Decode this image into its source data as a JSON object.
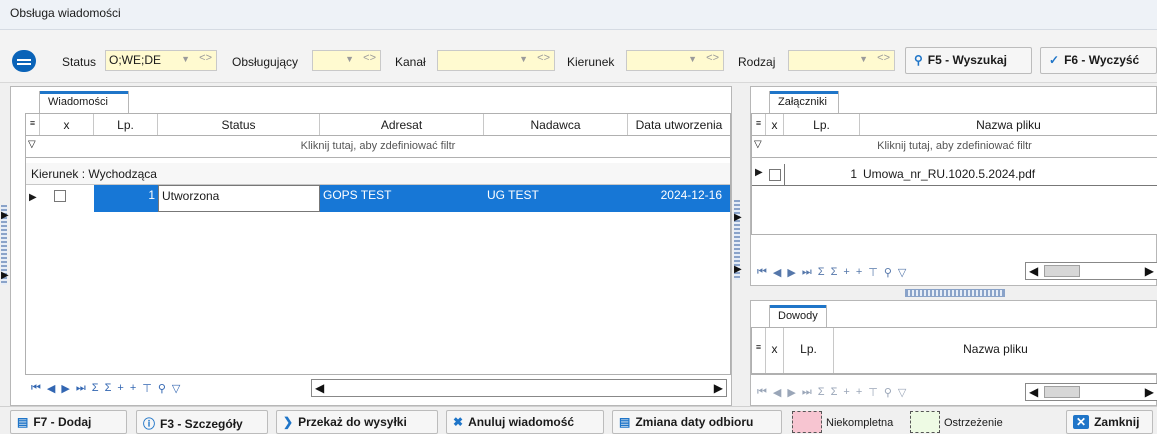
{
  "window": {
    "title": "Obsługa wiadomości"
  },
  "filters": {
    "status_label": "Status",
    "status_value": "O;WE;DE",
    "obslugujacy_label": "Obsługujący",
    "obslugujacy_value": "",
    "kanal_label": "Kanał",
    "kanal_value": "",
    "kierunek_label": "Kierunek",
    "kierunek_value": "",
    "rodzaj_label": "Rodzaj",
    "rodzaj_value": "",
    "search_button": "F5 - Wyszukaj",
    "clear_button": "F6 - Wyczyść",
    "field_color": "#fffad0"
  },
  "messages_tab": {
    "label": "Wiadomości",
    "columns": [
      "x",
      "Lp.",
      "Status",
      "Adresat",
      "Nadawca",
      "Data utworzenia"
    ],
    "filter_hint": "Kliknij tutaj, aby zdefiniować filtr",
    "group_label": "Kierunek : Wychodząca",
    "rows": [
      {
        "lp": "1",
        "status": "Utworzona",
        "adresat": "GOPS TEST",
        "nadawca": "UG TEST",
        "data": "2024-12-16"
      }
    ],
    "selected_color": "#1777d6"
  },
  "attachments_tab": {
    "label": "Załączniki",
    "columns": [
      "x",
      "Lp.",
      "Nazwa pliku"
    ],
    "filter_hint": "Kliknij tutaj, aby zdefiniować filtr",
    "rows": [
      {
        "lp": "1",
        "nazwa": "Umowa_nr_RU.1020.5.2024.pdf"
      }
    ]
  },
  "proofs_tab": {
    "label": "Dowody",
    "columns": [
      "x",
      "Lp.",
      "Nazwa pliku"
    ]
  },
  "bottom_bar": {
    "add_button": "F7 - Dodaj",
    "details_button": "F3 - Szczegóły",
    "send_button": "Przekaż do wysyłki",
    "cancel_message_button": "Anuluj wiadomość",
    "change_date_button": "Zmiana daty odbioru",
    "legend_incomplete": "Niekompletna",
    "legend_incomplete_color": "#f7c5d1",
    "legend_warning": "Ostrzeżenie",
    "legend_warning_color": "#eefbe4",
    "close_button": "Zamknij"
  }
}
